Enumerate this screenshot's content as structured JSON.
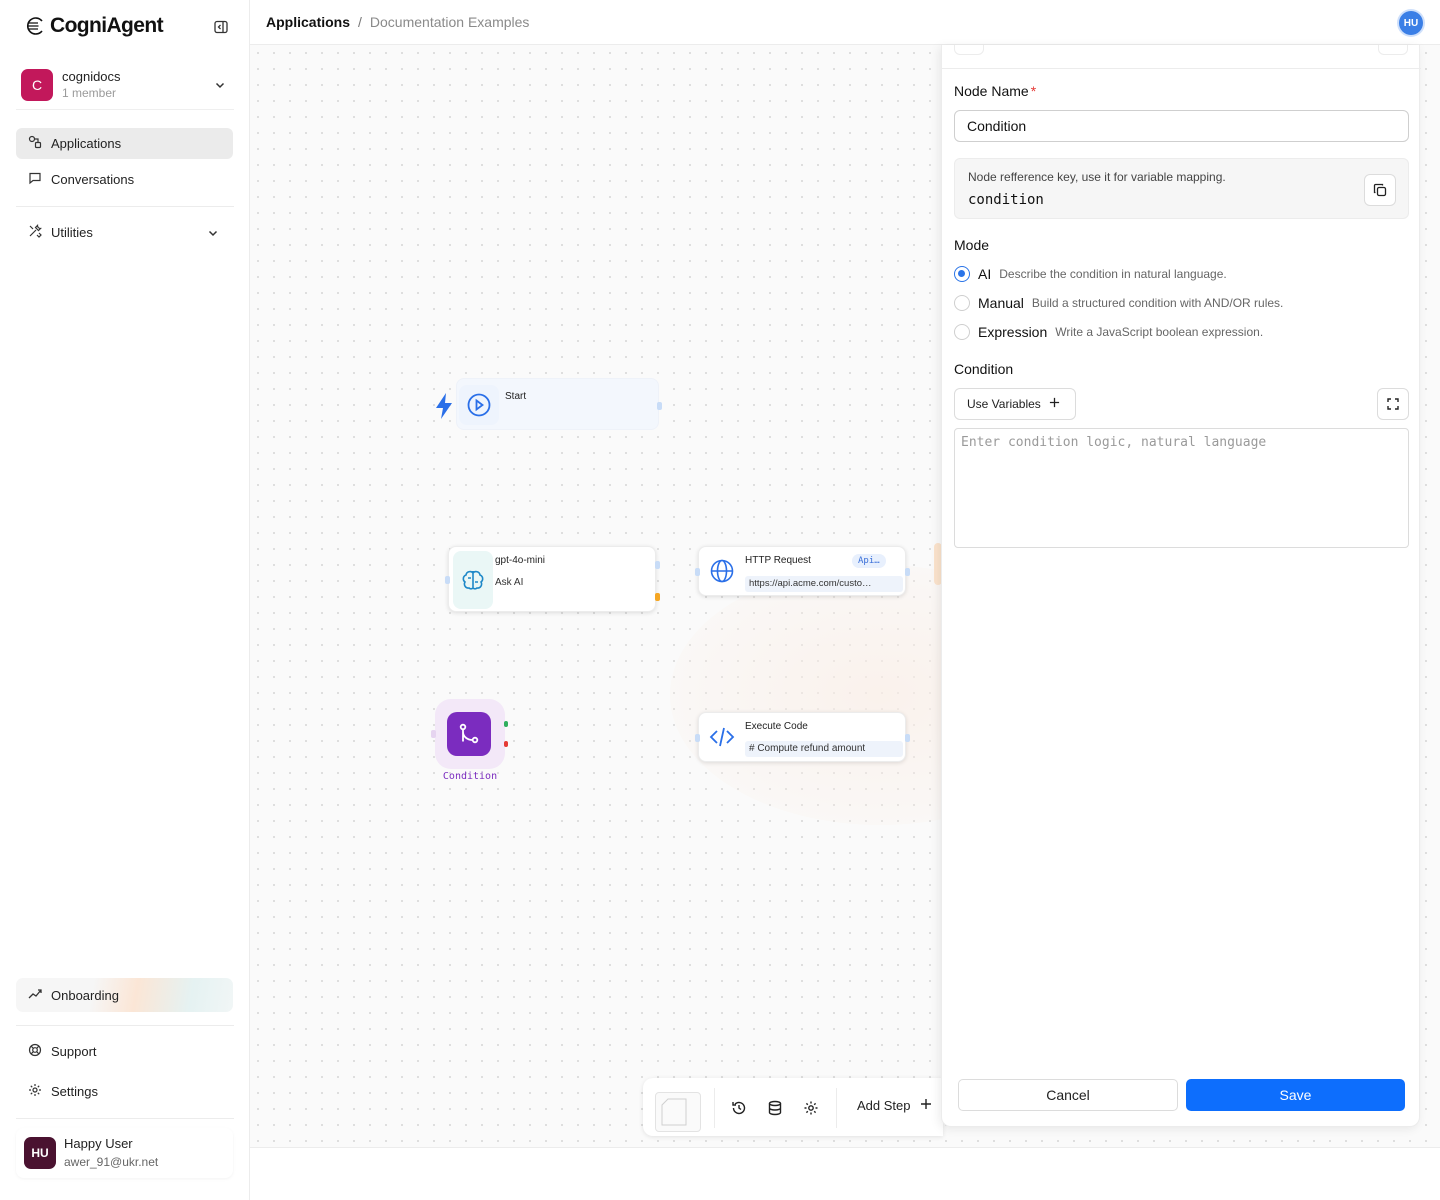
{
  "app": {
    "name": "CogniAgent"
  },
  "org": {
    "initial": "C",
    "name": "cognidocs",
    "members": "1 member"
  },
  "nav": {
    "applications": "Applications",
    "conversations": "Conversations",
    "utilities": "Utilities",
    "onboarding": "Onboarding",
    "support": "Support",
    "settings": "Settings"
  },
  "user": {
    "initials": "HU",
    "name": "Happy User",
    "email": "awer_91@ukr.net"
  },
  "header": {
    "crumb_root": "Applications",
    "crumb_sep": "/",
    "crumb_current": "Documentation Examples",
    "avatar": "HU"
  },
  "canvas": {
    "start": {
      "title": "Start"
    },
    "ai": {
      "title": "gpt-4o-mini",
      "subtitle": "Ask AI"
    },
    "http": {
      "title": "HTTP Request",
      "badge": "Api…",
      "url": "https://api.acme.com/custo…"
    },
    "condition": {
      "label": "Condition"
    },
    "code": {
      "title": "Execute Code",
      "line": "#  Compute  refund  amount"
    }
  },
  "toolbar": {
    "add_step": "Add Step"
  },
  "panel": {
    "node_name_label": "Node Name",
    "required_mark": "*",
    "node_name_value": "Condition",
    "ref_hint": "Node refference key, use it for variable mapping.",
    "ref_key": "condition",
    "mode_label": "Mode",
    "modes": [
      {
        "label": "AI",
        "desc": "Describe the condition in natural language.",
        "selected": true
      },
      {
        "label": "Manual",
        "desc": "Build a structured condition with AND/OR rules.",
        "selected": false
      },
      {
        "label": "Expression",
        "desc": "Write a JavaScript boolean expression.",
        "selected": false
      }
    ],
    "condition_label": "Condition",
    "use_variables": "Use Variables",
    "condition_placeholder": "Enter condition logic, natural language",
    "condition_value": "",
    "cancel": "Cancel",
    "save": "Save"
  },
  "colors": {
    "accent": "#0d6efd",
    "org_avatar": "#c2185b",
    "user_avatar": "#4a1230",
    "condition_node": "#7b2cbf"
  }
}
